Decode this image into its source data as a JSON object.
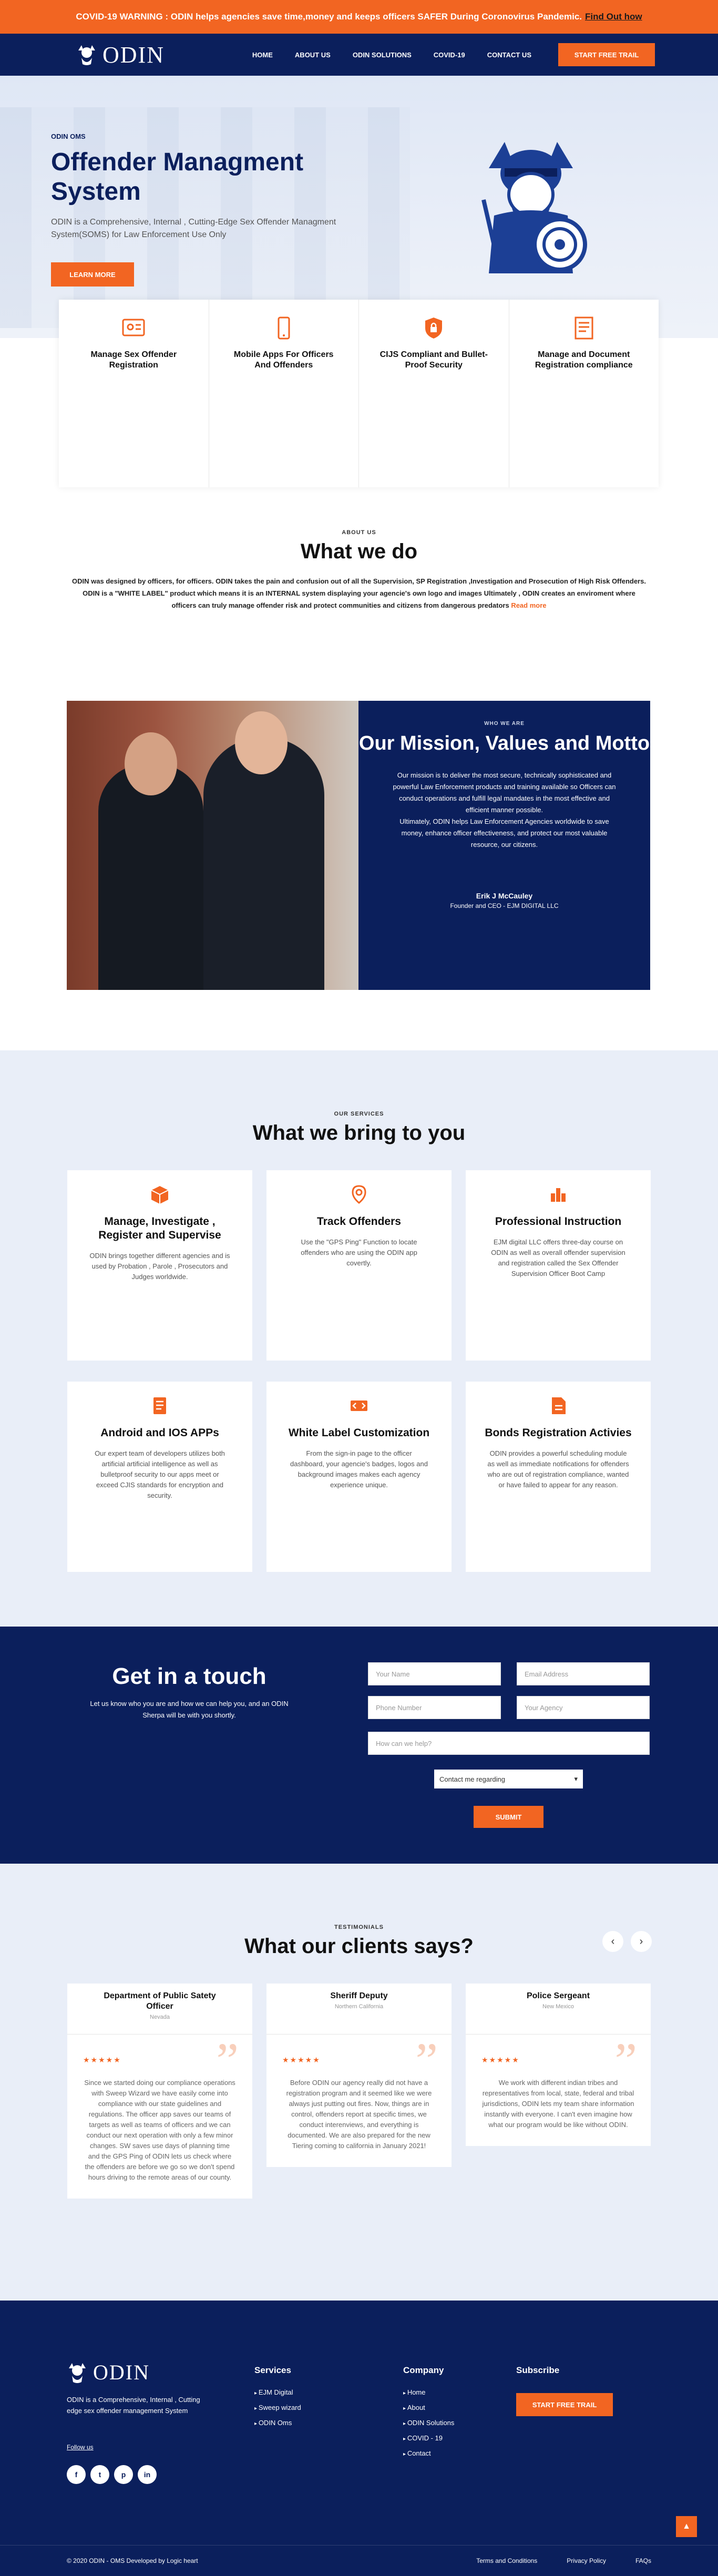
{
  "covid": {
    "text": "COVID-19 WARNING : ODIN helps agencies save time,money and keeps officers SAFER During Coronovirus Pandemic.",
    "link": "Find Out how"
  },
  "nav": {
    "logo": "ODIN",
    "items": [
      "HOME",
      "ABOUT US",
      "ODIN SOLUTIONS",
      "COVID-19",
      "CONTACT US"
    ],
    "cta": "START FREE TRAIL"
  },
  "hero": {
    "eyebrow": "ODIN OMS",
    "title": "Offender Managment System",
    "desc": "ODIN is a Comprehensive, Internal , Cutting-Edge Sex Offender Managment System(SOMS) for Law Enforcement Use Only",
    "cta": "LEARN MORE"
  },
  "features": [
    {
      "title": "Manage Sex Offender Registration",
      "icon": "registration-icon"
    },
    {
      "title": "Mobile Apps For Officers And Offenders",
      "icon": "mobile-icon"
    },
    {
      "title": "CIJS Compliant and Bullet-Proof Security",
      "icon": "security-lock-icon"
    },
    {
      "title": "Manage and Document Registration compliance",
      "icon": "document-icon"
    }
  ],
  "about": {
    "eyebrow": "ABOUT US",
    "title": "What we do",
    "text": "ODIN was designed by officers, for officers. ODIN takes the pain and confusion out of all the Supervision, SP Registration ,Investigation and Prosecution of High Risk Offenders. ODIN is a \"WHITE LABEL\" product which means it is an INTERNAL system displaying your agencie's own logo and images Ultimately , ODIN creates an enviroment where officers can truly manage offender risk and protect communities and citizens from dangerous predators",
    "read_more": "Read more"
  },
  "mission": {
    "eyebrow": "WHO WE ARE",
    "title": "Our Mission, Values and Motto",
    "text1": "Our mission is to deliver the most secure, technically sophisticated and powerful Law Enforcement products and training available so Officers can conduct operations and fulfill legal mandates in the most effective and efficient manner possible.",
    "text2": "Ultimately, ODIN helps Law Enforcement Agencies worldwide to save money, enhance officer effectiveness, and protect our most valuable resource, our citizens.",
    "author": "Erik J McCauley",
    "role": "Founder and CEO - EJM DIGITAL LLC"
  },
  "services": {
    "eyebrow": "OUR SERVICES",
    "title": "What we bring to you",
    "items": [
      {
        "title": "Manage, Investigate , Register and Supervise",
        "text": "ODIN brings together different agencies and is used by Probation , Parole , Prosecutors and Judges worldwide.",
        "icon": "box-icon"
      },
      {
        "title": "Track Offenders",
        "text": "Use the \"GPS Ping\" Function to locate offenders who are using the ODIN app covertly.",
        "icon": "location-pin-icon"
      },
      {
        "title": "Professional Instruction",
        "text": "EJM digital LLC offers three-day course on ODIN as well as overall offender supervision and registration called the Sex Offender Supervision Officer Boot Camp",
        "icon": "bar-chart-icon"
      },
      {
        "title": "Android and IOS APPs",
        "text": "Our expert team of developers utilizes both artificial artificial intelligence as well as bulletproof security to our apps meet or exceed CJIS standards for encryption and security.",
        "icon": "document-list-icon"
      },
      {
        "title": "White Label Customization",
        "text": "From the sign-in page to the officer dashboard, your agencie's badges, logos and background images makes each agency experience unique.",
        "icon": "customize-icon"
      },
      {
        "title": "Bonds Registration Activies",
        "text": "ODIN provides a powerful scheduling module as well as immediate notifications for offenders who are out of registration compliance, wanted or have failed to appear for any reason.",
        "icon": "bond-file-icon"
      }
    ]
  },
  "contact": {
    "title": "Get in a touch",
    "subtitle": "Let us know who you are and how we can help you, and an ODIN Sherpa will be with you shortly.",
    "name_placeholder": "Your Name",
    "email_placeholder": "Email Address",
    "phone_placeholder": "Phone Number",
    "agency_placeholder": "Your Agency",
    "help_placeholder": "How can we help?",
    "select_value": "Contact me regarding",
    "submit": "SUBMIT"
  },
  "testimonials": {
    "eyebrow": "TESTIMONIALS",
    "title": "What our clients says?",
    "items": [
      {
        "role": "Department of Public Satety Officer",
        "location": "Nevada",
        "stars": "★★★★★",
        "text": "Since we started doing our compliance operations with Sweep Wizard we have easily come into compliance with our state guidelines and regulations. The officer app saves our teams of targets as well as teams of officers and we can conduct our next operation with only a few minor changes. SW saves use days of planning time and the GPS Ping of ODIN lets us check where the offenders are before we go so we don't spend hours driving to the remote areas of our county."
      },
      {
        "role": "Sheriff Deputy",
        "location": "Northern California",
        "stars": "★★★★★",
        "text": "Before ODIN our agency really did not have a registration program and it seemed like we were always just putting out fires. Now, things are in control, offenders report at specific times, we conduct interenviews, and everything is documented. We are also prepared for the new Tiering coming to california in January 2021!"
      },
      {
        "role": "Police Sergeant",
        "location": "New Mexico",
        "stars": "★★★★★",
        "text": "We work with different indian tribes and representatives from local, state, federal and tribal jurisdictions, ODIN lets my team share information instantly with everyone. I can't even imagine how what our program would be like without ODIN."
      }
    ]
  },
  "footer": {
    "logo": "ODIN",
    "desc": "ODIN is a Comprehensive, Internal , Cutting edge sex offender management System",
    "follow": "Follow us",
    "socials": [
      "f",
      "t",
      "p",
      "in"
    ],
    "services_title": "Services",
    "services": [
      "EJM Digital",
      "Sweep wizard",
      "ODIN Oms"
    ],
    "company_title": "Company",
    "company": [
      "Home",
      "About",
      "ODIN Solutions",
      "COVID - 19",
      "Contact"
    ],
    "subscribe_title": "Subscribe",
    "cta": "START FREE TRAIL",
    "copyright": "© 2020 ODIN - OMS Developed by Logic heart",
    "links": [
      "Terms and Conditions",
      "Privacy Policy",
      "FAQs"
    ]
  },
  "colors": {
    "navy": "#0b1f5c",
    "orange": "#f26522",
    "light_bg": "#e9eef8"
  }
}
